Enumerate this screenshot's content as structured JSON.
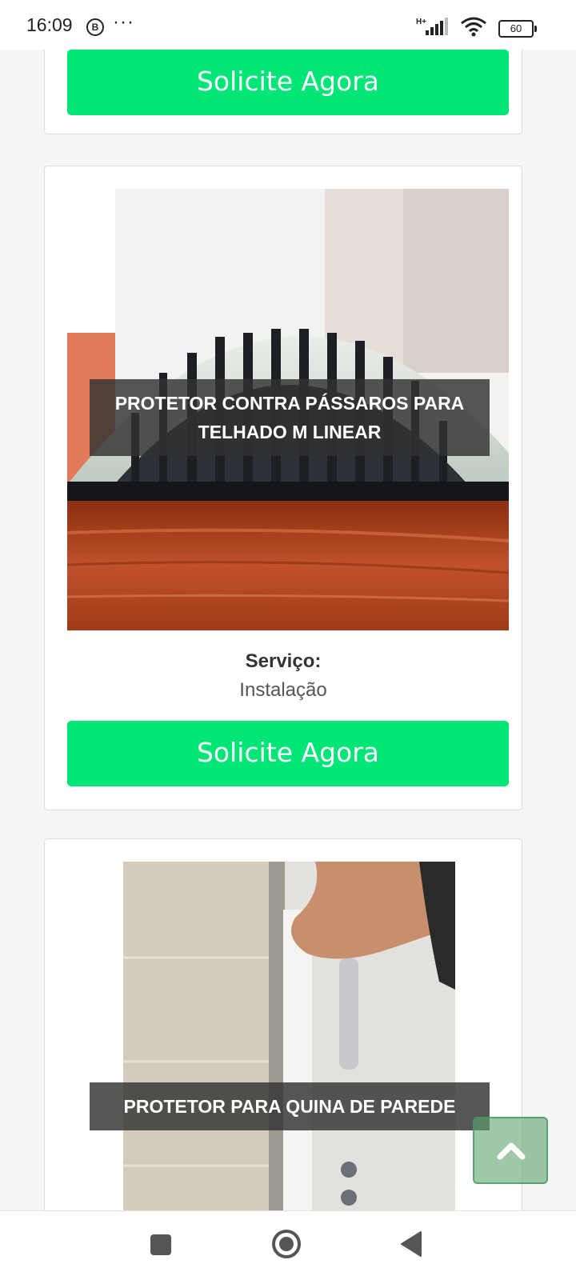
{
  "status_bar": {
    "time": "16:09",
    "notif_icon_letter": "B",
    "more": "···",
    "network_type": "H+",
    "battery": "60"
  },
  "cards": [
    {
      "cta_label": "Solicite Agora"
    },
    {
      "caption": "PROTETOR CONTRA PÁSSAROS PARA TELHADO M LINEAR",
      "service_label": "Serviço:",
      "service_value": "Instalação",
      "cta_label": "Solicite Agora"
    },
    {
      "caption": "PROTETOR PARA QUINA DE PAREDE"
    }
  ],
  "colors": {
    "cta": "#00e676",
    "background": "#f5f5f5",
    "back_to_top": "#5ca570"
  },
  "icons": {
    "back_to_top": "chevron-up-icon",
    "nav_recents": "square-icon",
    "nav_home": "circle-icon",
    "nav_back": "triangle-back-icon"
  }
}
